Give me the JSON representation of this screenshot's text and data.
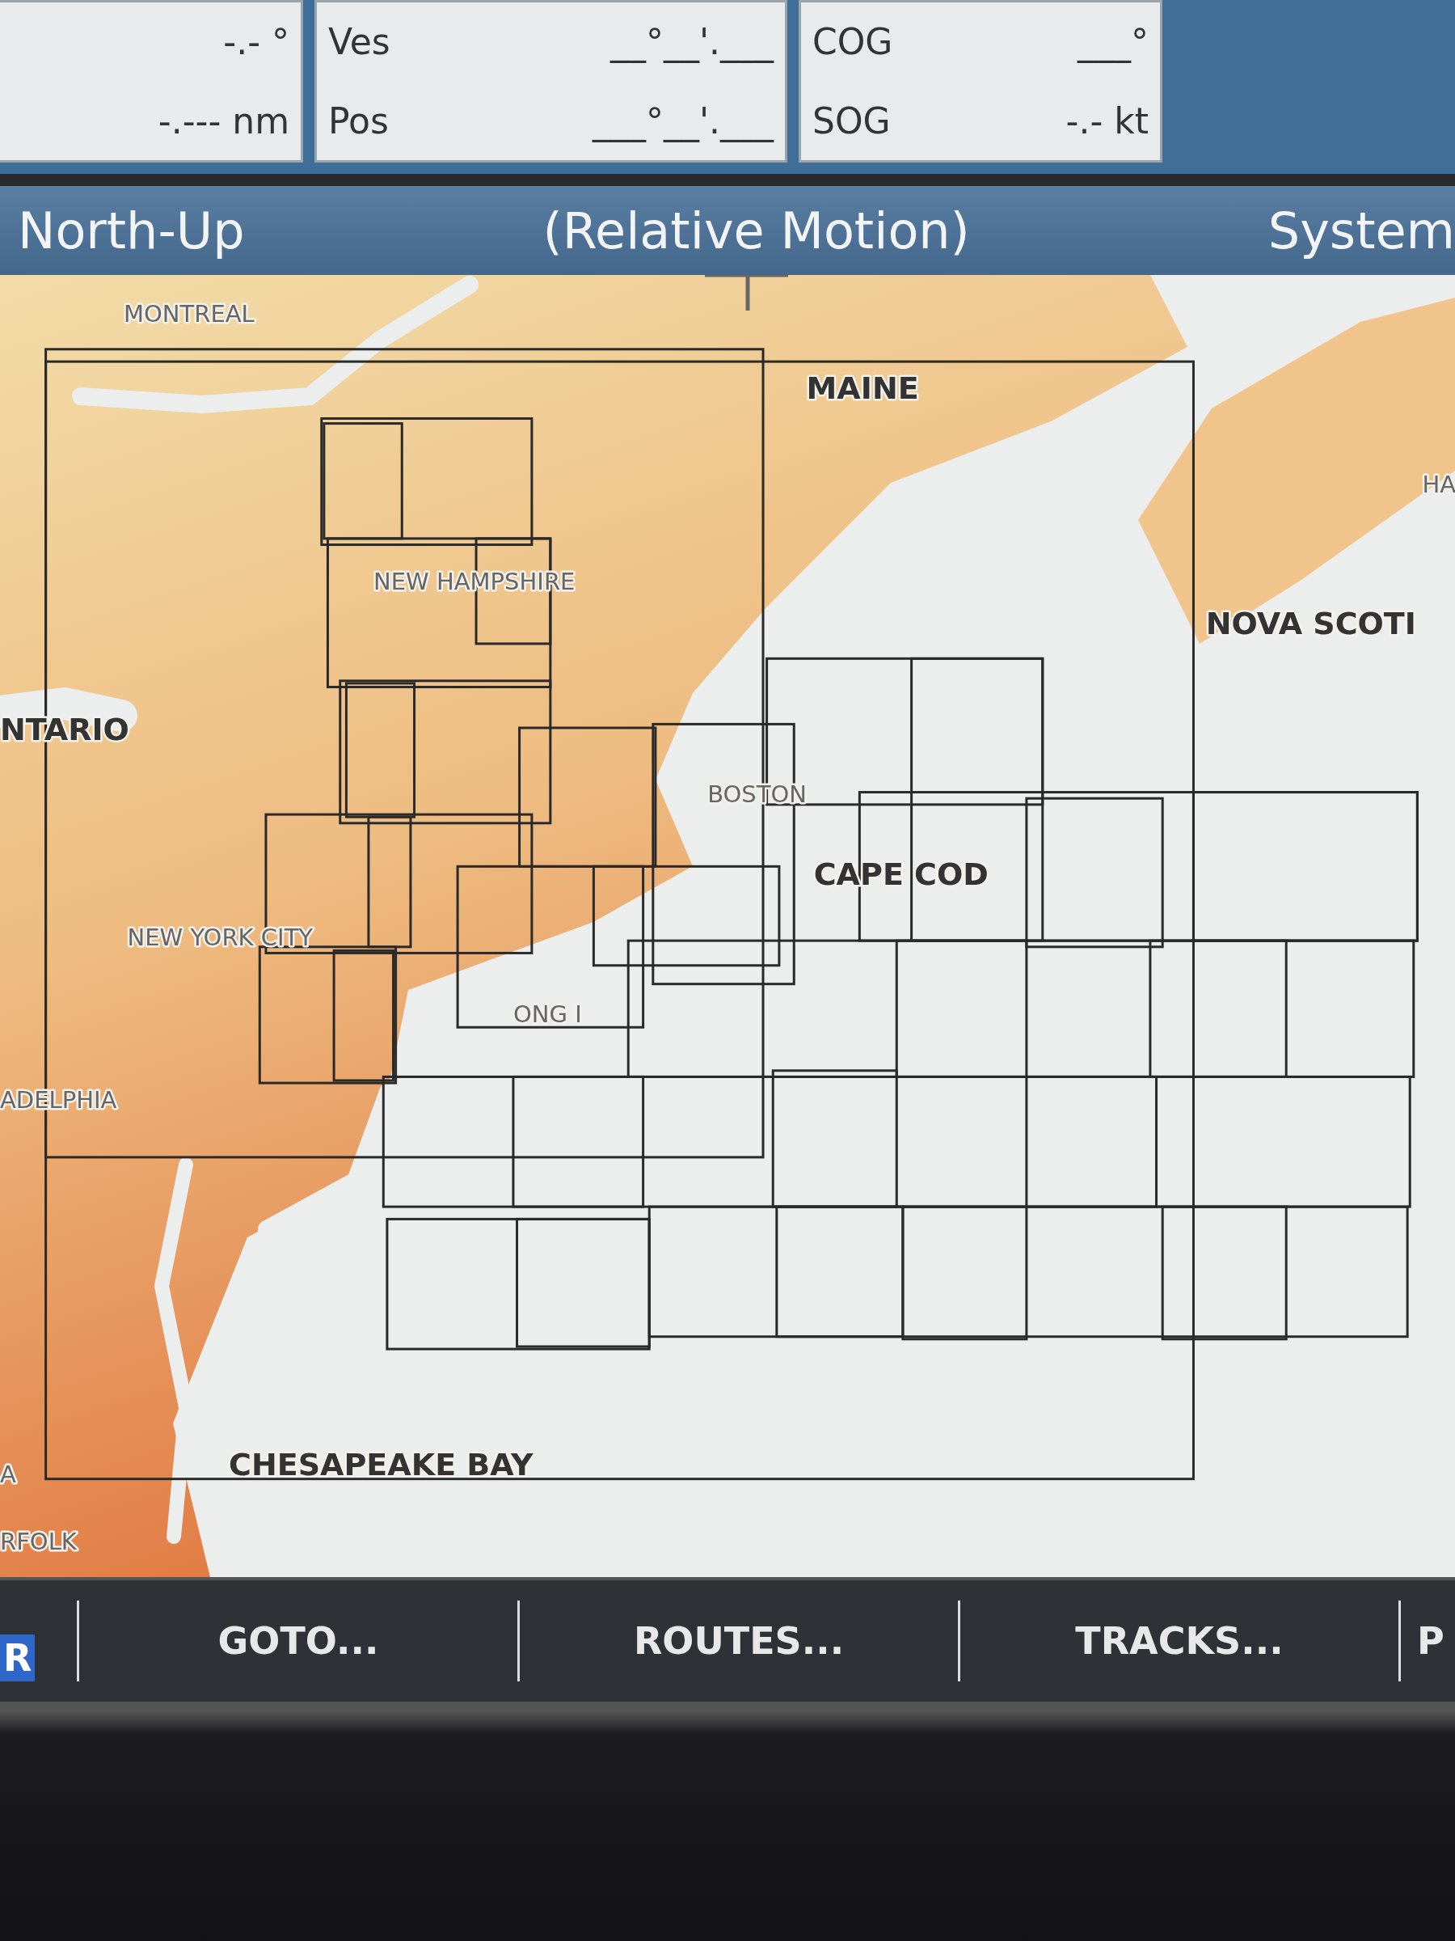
{
  "readouts": [
    {
      "items": [
        {
          "value": "-.- °"
        },
        {
          "value": "-.--- nm"
        }
      ]
    },
    {
      "items": [
        {
          "label": "Ves",
          "value": "__°__'.___"
        },
        {
          "label": "Pos",
          "value": "___°__'.___"
        }
      ]
    },
    {
      "items": [
        {
          "label": "COG",
          "value": "___°"
        },
        {
          "label": "SOG",
          "value": "-.- kt"
        }
      ]
    }
  ],
  "header": {
    "orientation": "North-Up",
    "mode": "(Relative Motion)",
    "menu": "System"
  },
  "map_labels": [
    {
      "text": "MONTREAL",
      "kind": "minor"
    },
    {
      "text": "MAINE",
      "kind": "major"
    },
    {
      "text": "NEW HAMPSHIRE",
      "kind": "minor"
    },
    {
      "text": "NTARIO",
      "kind": "major"
    },
    {
      "text": "BOSTON",
      "kind": "minor"
    },
    {
      "text": "CAPE COD",
      "kind": "major"
    },
    {
      "text": "NEW YORK CITY",
      "kind": "minor"
    },
    {
      "text": "ONG I",
      "kind": "minor"
    },
    {
      "text": "ADELPHIA",
      "kind": "minor"
    },
    {
      "text": "NOVA SCOTI",
      "kind": "major"
    },
    {
      "text": "A",
      "kind": "minor"
    },
    {
      "text": "CHESAPEAKE BAY",
      "kind": "major"
    },
    {
      "text": "RFOLK",
      "kind": "minor"
    },
    {
      "text": "HA",
      "kind": "minor"
    }
  ],
  "softkeys": [
    {
      "label": "R",
      "selected": true
    },
    {
      "label": "GOTO...",
      "selected": false
    },
    {
      "label": "ROUTES...",
      "selected": false
    },
    {
      "label": "TRACKS...",
      "selected": false
    },
    {
      "label": "P",
      "selected": false
    }
  ]
}
